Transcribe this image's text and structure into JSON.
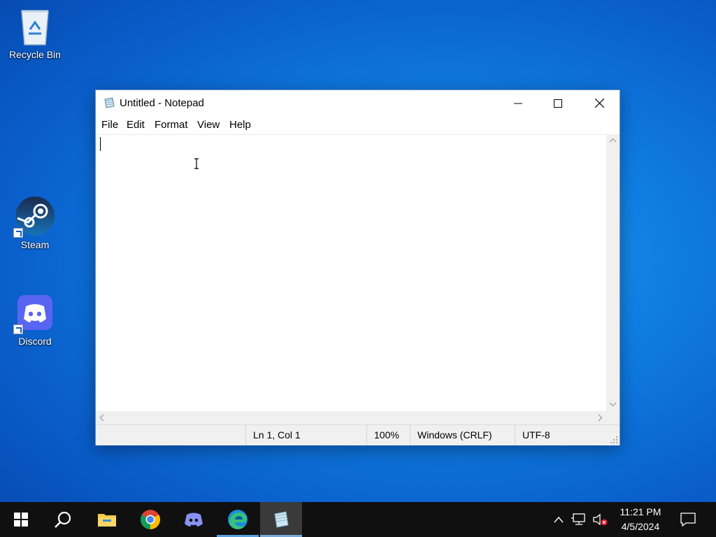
{
  "desktop": {
    "icons": [
      {
        "label": "Recycle Bin"
      },
      {
        "label": "Steam"
      },
      {
        "label": "Discord"
      }
    ]
  },
  "window": {
    "title": "Untitled - Notepad",
    "menu": [
      "File",
      "Edit",
      "Format",
      "View",
      "Help"
    ],
    "editor_text": "",
    "status": {
      "position": "Ln 1, Col 1",
      "zoom": "100%",
      "line_ending": "Windows (CRLF)",
      "encoding": "UTF-8"
    }
  },
  "taskbar": {
    "apps": [
      "start",
      "search",
      "file-explorer",
      "chrome",
      "discord",
      "edge",
      "notepad"
    ],
    "active_app": "notepad",
    "clock": {
      "time": "11:21 PM",
      "date": "4/5/2024"
    }
  },
  "colors": {
    "taskbar": "#101010",
    "desktop_accent": "#0f7ee3",
    "discord": "#5865f2"
  }
}
